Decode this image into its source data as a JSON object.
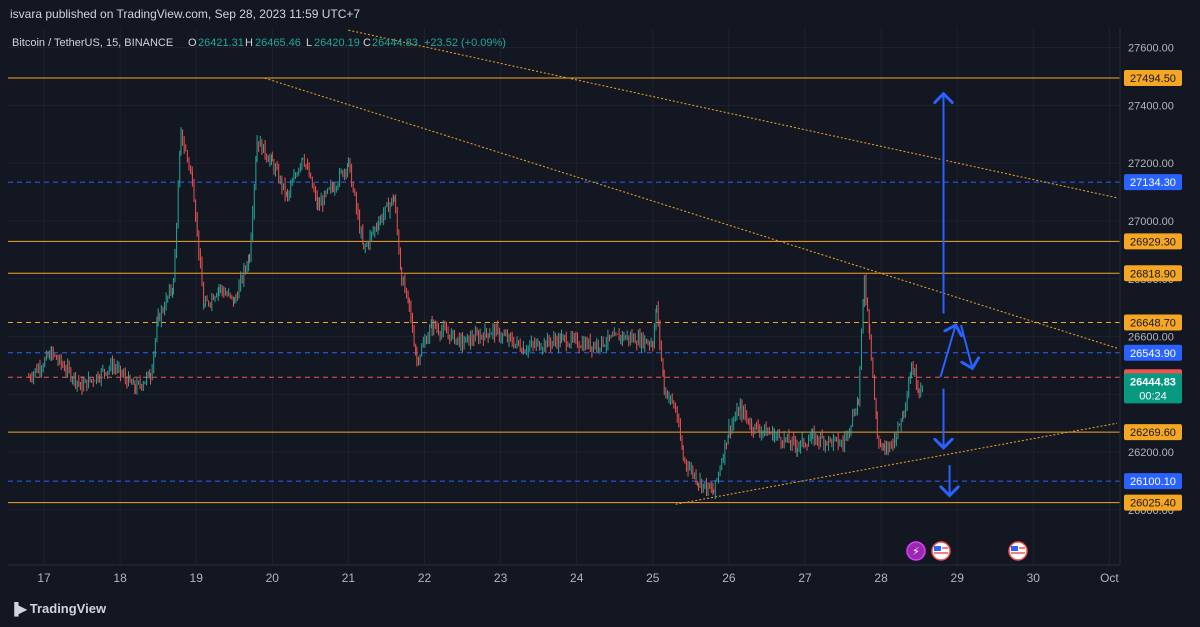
{
  "header": {
    "published": "isvara published on TradingView.com, Sep 28, 2023 11:59 UTC+7"
  },
  "legend": {
    "symbol": "Bitcoin / TetherUS, 15, BINANCE",
    "o_label": "O",
    "o_value": "26421.31",
    "h_label": "H",
    "h_value": "26465.46",
    "l_label": "L",
    "l_value": "26420.19",
    "c_label": "C",
    "c_value": "26444.83",
    "change": "+23.52 (+0.09%)"
  },
  "footer": {
    "brand": "TradingView"
  },
  "colors": {
    "background": "#131722",
    "up": "#26a69a",
    "down": "#ef5350",
    "orange": "#f5a623",
    "blue": "#2962ff",
    "grid": "#1e222d"
  },
  "chart_data": {
    "type": "candlestick",
    "symbol": "Bitcoin / TetherUS",
    "interval": "15",
    "exchange": "BINANCE",
    "ylim": [
      25980,
      27660
    ],
    "y_ticks": [
      "27600.00",
      "27400.00",
      "27200.00",
      "27000.00",
      "26800.00",
      "26600.00",
      "26400.00",
      "26200.00",
      "26000.00"
    ],
    "x_ticks": [
      "17",
      "18",
      "19",
      "20",
      "21",
      "22",
      "23",
      "24",
      "25",
      "26",
      "27",
      "28",
      "29",
      "30",
      "Oct"
    ],
    "last_price": "26444.83",
    "countdown": "00:24",
    "horizontal_levels": [
      {
        "price": "27494.50",
        "style": "solid",
        "color": "#f5a623"
      },
      {
        "price": "27134.30",
        "style": "dashed",
        "color": "#2962ff"
      },
      {
        "price": "26929.30",
        "style": "solid",
        "color": "#f5a623"
      },
      {
        "price": "26818.90",
        "style": "solid",
        "color": "#f5a623"
      },
      {
        "price": "26648.70",
        "style": "dashed",
        "color": "#f5a623"
      },
      {
        "price": "26543.90",
        "style": "dashed",
        "color": "#2962ff"
      },
      {
        "price": "26459.20",
        "style": "dashed",
        "color": "#ef5350"
      },
      {
        "price": "26269.60",
        "style": "solid",
        "color": "#f5a623"
      },
      {
        "price": "26100.10",
        "style": "dashed",
        "color": "#2962ff"
      },
      {
        "price": "26025.40",
        "style": "solid",
        "color": "#f5a623"
      }
    ],
    "trendlines": [
      {
        "from": [
          "19.9",
          27494
        ],
        "to": [
          "31.1",
          26560
        ]
      },
      {
        "from": [
          "25.3",
          26020
        ],
        "to": [
          "31.1",
          26300
        ]
      },
      {
        "from": [
          "21.0",
          27660
        ],
        "to": [
          "31.1",
          27080
        ]
      }
    ],
    "price_path": [
      {
        "x": 16.8,
        "y": 26460
      },
      {
        "x": 17.1,
        "y": 26540
      },
      {
        "x": 17.5,
        "y": 26430
      },
      {
        "x": 17.9,
        "y": 26500
      },
      {
        "x": 18.2,
        "y": 26420
      },
      {
        "x": 18.4,
        "y": 26470
      },
      {
        "x": 18.5,
        "y": 26660
      },
      {
        "x": 18.7,
        "y": 26780
      },
      {
        "x": 18.8,
        "y": 27300
      },
      {
        "x": 18.95,
        "y": 27150
      },
      {
        "x": 19.1,
        "y": 26700
      },
      {
        "x": 19.3,
        "y": 26770
      },
      {
        "x": 19.5,
        "y": 26720
      },
      {
        "x": 19.7,
        "y": 26880
      },
      {
        "x": 19.8,
        "y": 27280
      },
      {
        "x": 20.0,
        "y": 27200
      },
      {
        "x": 20.2,
        "y": 27080
      },
      {
        "x": 20.4,
        "y": 27230
      },
      {
        "x": 20.6,
        "y": 27050
      },
      {
        "x": 20.8,
        "y": 27120
      },
      {
        "x": 21.0,
        "y": 27200
      },
      {
        "x": 21.2,
        "y": 26900
      },
      {
        "x": 21.4,
        "y": 27000
      },
      {
        "x": 21.6,
        "y": 27080
      },
      {
        "x": 21.7,
        "y": 26800
      },
      {
        "x": 21.8,
        "y": 26700
      },
      {
        "x": 21.9,
        "y": 26520
      },
      {
        "x": 22.1,
        "y": 26640
      },
      {
        "x": 22.5,
        "y": 26580
      },
      {
        "x": 22.9,
        "y": 26620
      },
      {
        "x": 23.3,
        "y": 26560
      },
      {
        "x": 23.8,
        "y": 26590
      },
      {
        "x": 24.2,
        "y": 26570
      },
      {
        "x": 24.6,
        "y": 26600
      },
      {
        "x": 25.0,
        "y": 26580
      },
      {
        "x": 25.05,
        "y": 26700
      },
      {
        "x": 25.15,
        "y": 26420
      },
      {
        "x": 25.3,
        "y": 26350
      },
      {
        "x": 25.4,
        "y": 26180
      },
      {
        "x": 25.6,
        "y": 26100
      },
      {
        "x": 25.8,
        "y": 26060
      },
      {
        "x": 26.0,
        "y": 26280
      },
      {
        "x": 26.15,
        "y": 26350
      },
      {
        "x": 26.3,
        "y": 26290
      },
      {
        "x": 26.6,
        "y": 26260
      },
      {
        "x": 26.9,
        "y": 26220
      },
      {
        "x": 27.1,
        "y": 26250
      },
      {
        "x": 27.5,
        "y": 26230
      },
      {
        "x": 27.7,
        "y": 26380
      },
      {
        "x": 27.78,
        "y": 26800
      },
      {
        "x": 27.85,
        "y": 26620
      },
      {
        "x": 27.95,
        "y": 26250
      },
      {
        "x": 28.05,
        "y": 26200
      },
      {
        "x": 28.2,
        "y": 26260
      },
      {
        "x": 28.3,
        "y": 26350
      },
      {
        "x": 28.4,
        "y": 26500
      },
      {
        "x": 28.5,
        "y": 26420
      },
      {
        "x": 28.55,
        "y": 26445
      }
    ],
    "projection_arrows": [
      {
        "from": [
          "28.82",
          26680
        ],
        "to": [
          "28.82",
          27440
        ]
      },
      {
        "from": [
          "28.78",
          26460
        ],
        "to": [
          "28.98",
          26640
        ]
      },
      {
        "from": [
          "29.05",
          26640
        ],
        "to": [
          "29.2",
          26490
        ]
      },
      {
        "from": [
          "28.82",
          26420
        ],
        "to": [
          "28.82",
          26215
        ]
      },
      {
        "from": [
          "28.9",
          26155
        ],
        "to": [
          "28.9",
          26050
        ]
      }
    ]
  }
}
